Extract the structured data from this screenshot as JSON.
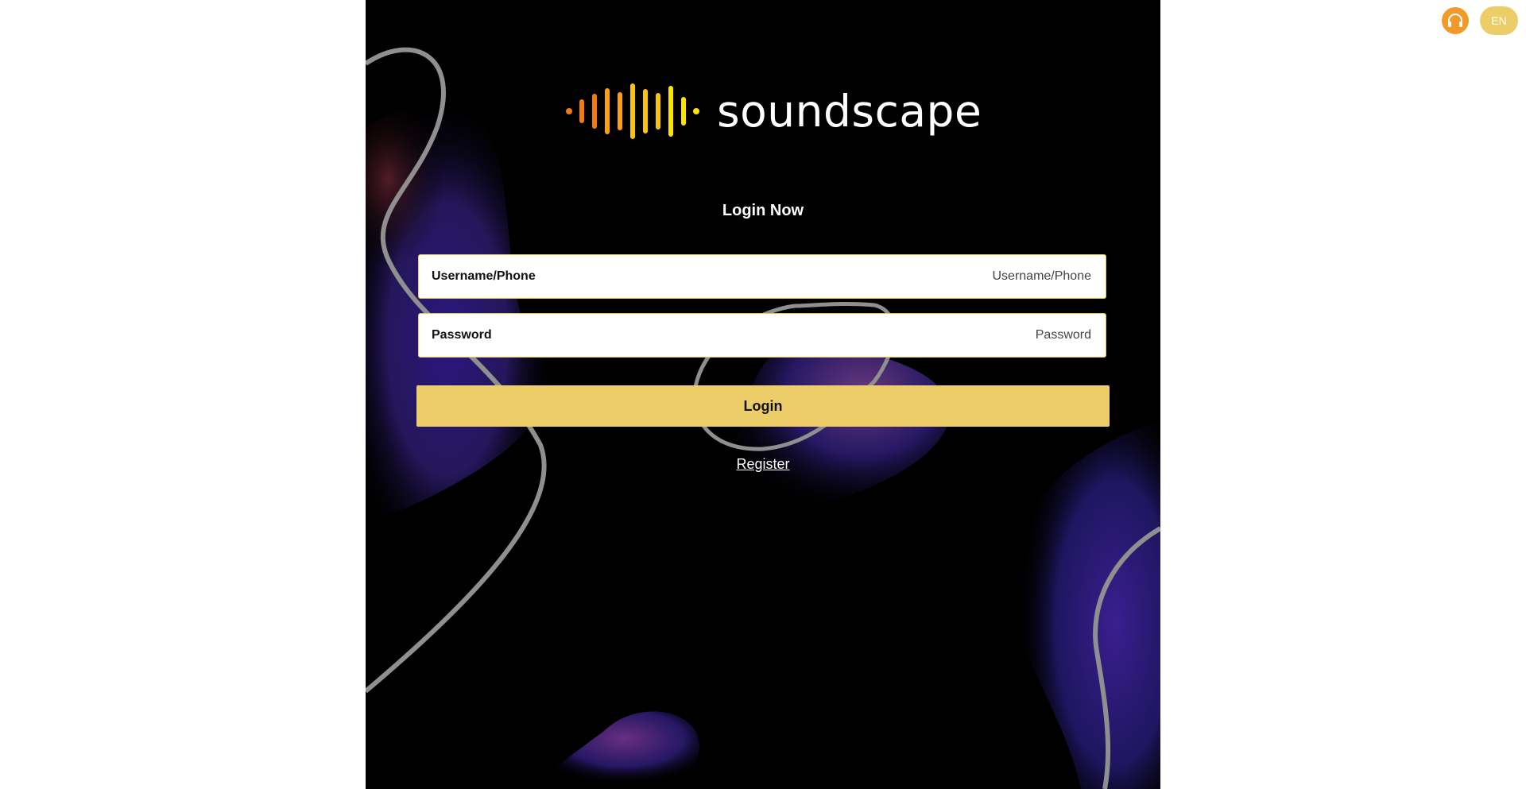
{
  "brand": {
    "name": "soundscape",
    "wave_colors": [
      "#f47a10",
      "#f7a012",
      "#f9c40f",
      "#fde300"
    ]
  },
  "login_form": {
    "title": "Login Now",
    "username": {
      "label": "Username/Phone",
      "placeholder": "Username/Phone",
      "value": ""
    },
    "password": {
      "label": "Password",
      "placeholder": "Password",
      "value": ""
    },
    "submit_label": "Login",
    "register_label": "Register"
  },
  "top_bar": {
    "support_icon": "headset-icon",
    "language_label": "EN"
  },
  "colors": {
    "accent": "#eccd68",
    "panel_background": "#000000",
    "support_orange": "#f19a2a"
  }
}
